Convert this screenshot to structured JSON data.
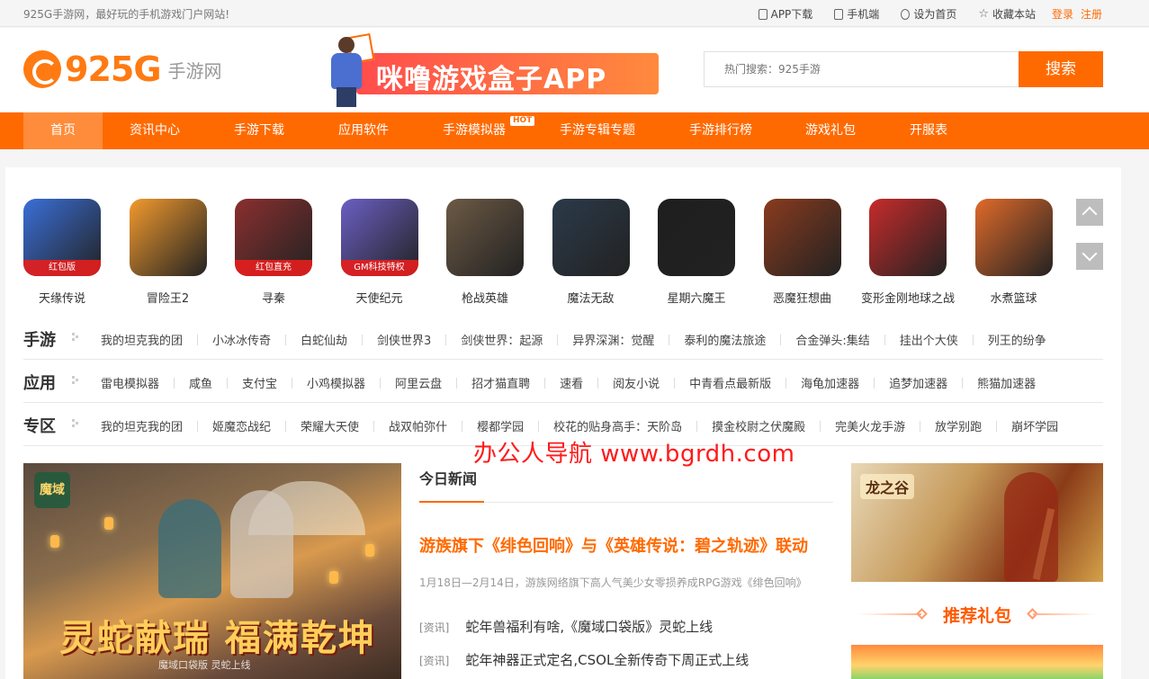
{
  "topbar": {
    "slogan": "925G手游网，最好玩的手机游戏门户网站!",
    "links": [
      "APP下载",
      "手机端",
      "设为首页",
      "收藏本站"
    ],
    "login": "登录",
    "register": "注册"
  },
  "header": {
    "logo_num": "925G",
    "logo_text": "手游网",
    "banner_title": "咪噜游戏盒子APP",
    "search_placeholder": "热门搜索：925手游",
    "search_button": "搜索"
  },
  "nav": {
    "items": [
      "首页",
      "资讯中心",
      "手游下载",
      "应用软件",
      "手游模拟器",
      "手游专辑专题",
      "手游排行榜",
      "游戏礼包",
      "开服表"
    ],
    "hot_badge": "HOT",
    "active": "首页"
  },
  "games": [
    {
      "name": "天缘传说",
      "badge": "红包版",
      "color": "#3a6fd8"
    },
    {
      "name": "冒险王2",
      "badge": "",
      "color": "#f29a2e"
    },
    {
      "name": "寻秦",
      "badge": "红包直充",
      "color": "#8b2f2f"
    },
    {
      "name": "天使纪元",
      "badge": "GM科技特权",
      "color": "#6b5fc4"
    },
    {
      "name": "枪战英雄",
      "badge": "",
      "color": "#6d5a45"
    },
    {
      "name": "魔法无敌",
      "badge": "",
      "color": "#2b3a4a"
    },
    {
      "name": "星期六魔王",
      "badge": "",
      "color": "#1e1e1e"
    },
    {
      "name": "恶魔狂想曲",
      "badge": "",
      "color": "#8a3b1e"
    },
    {
      "name": "变形金刚地球之战",
      "badge": "",
      "color": "#c72b2b"
    },
    {
      "name": "水煮篮球",
      "badge": "",
      "color": "#e06a2a"
    }
  ],
  "categories": [
    {
      "label": "手游",
      "items": [
        "我的坦克我的团",
        "小冰冰传奇",
        "白蛇仙劫",
        "剑侠世界3",
        "剑侠世界：起源",
        "异界深渊：觉醒",
        "泰利的魔法旅途",
        "合金弹头:集结",
        "挂出个大侠",
        "列王的纷争"
      ]
    },
    {
      "label": "应用",
      "items": [
        "雷电模拟器",
        "咸鱼",
        "支付宝",
        "小鸡模拟器",
        "阿里云盘",
        "招才猫直聘",
        "速看",
        "阅友小说",
        "中青看点最新版",
        "海龟加速器",
        "追梦加速器",
        "熊猫加速器"
      ]
    },
    {
      "label": "专区",
      "items": [
        "我的坦克我的团",
        "姬魔恋战纪",
        "荣耀大天使",
        "战双帕弥什",
        "樱都学园",
        "校花的贴身高手：天阶岛",
        "摸金校尉之伏魔殿",
        "完美火龙手游",
        "放学别跑",
        "崩坏学园"
      ]
    }
  ],
  "watermark": "办公人导航 www.bgrdh.com",
  "feature": {
    "tag": "魔域",
    "slogan": "灵蛇献瑞 福满乾坤",
    "caption": "魔域口袋版 灵蛇上线"
  },
  "news": {
    "heading": "今日新闻",
    "top_title": "游族旗下《绯色回响》与《英雄传说：碧之轨迹》联动",
    "top_desc": "1月18日—2月14日，游族网络旗下高人气美少女零损养成RPG游戏《绯色回响》",
    "lines": [
      {
        "tag": "[资讯]",
        "text": "蛇年兽福利有啥,《魔域口袋版》灵蛇上线"
      },
      {
        "tag": "[资讯]",
        "text": "蛇年神器正式定名,CSOL全新传奇下周正式上线"
      }
    ]
  },
  "side": {
    "game_logo": "龙之谷",
    "gift_title": "推荐礼包"
  }
}
